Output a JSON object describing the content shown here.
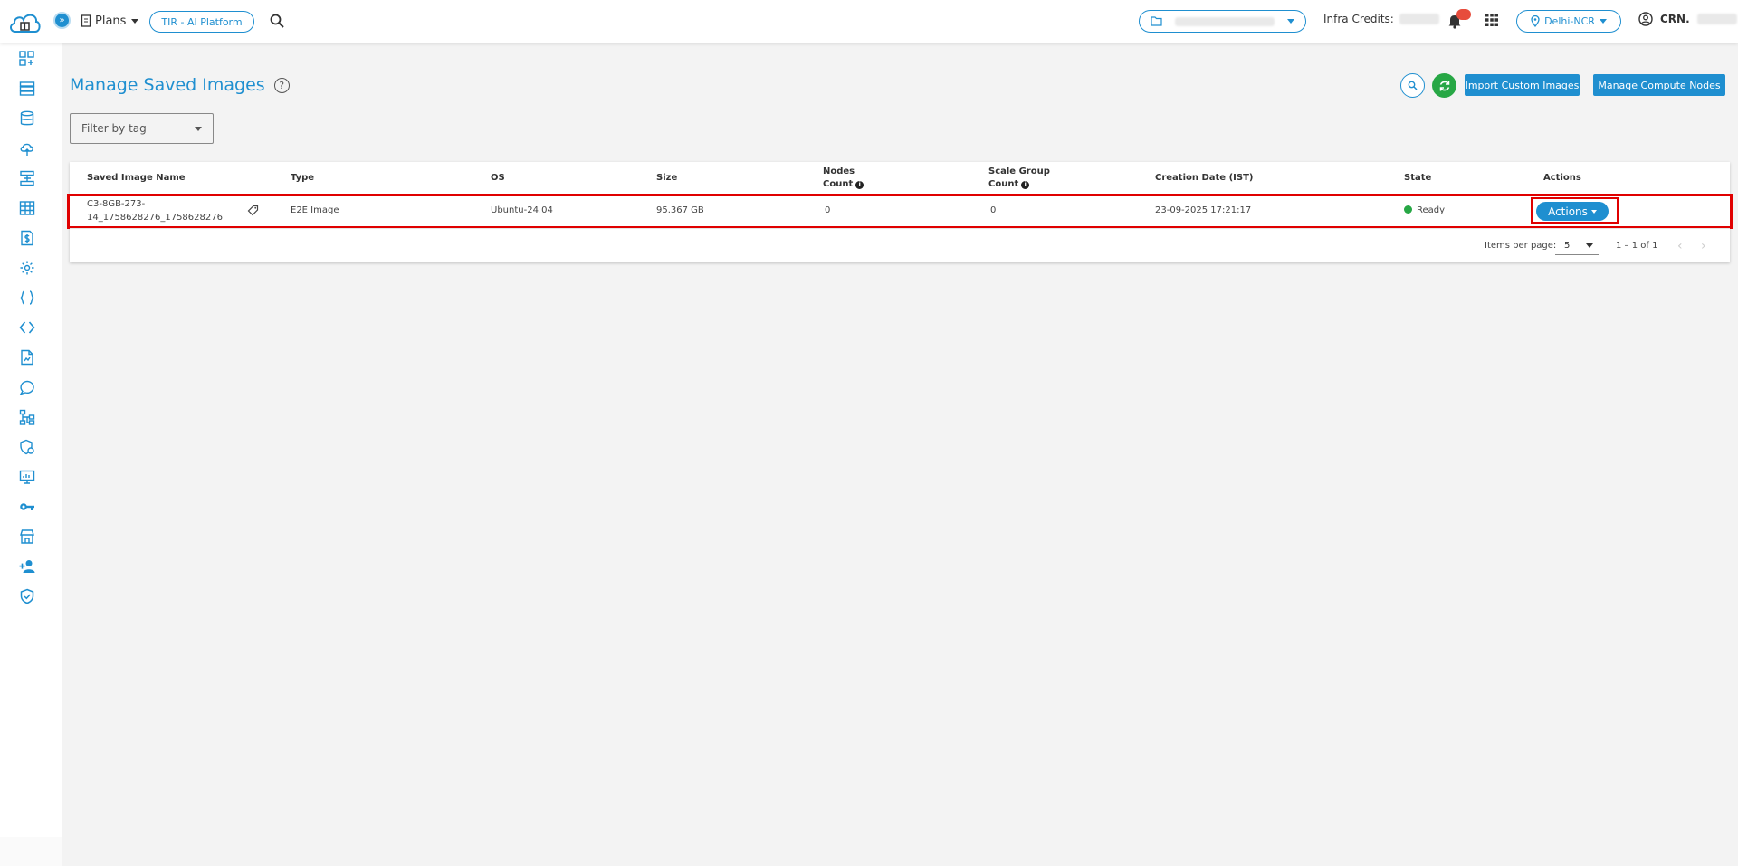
{
  "header": {
    "plans_label": "Plans",
    "platform_label": "TIR - AI Platform",
    "infra_credits_label": "Infra Credits:",
    "region_label": "Delhi-NCR",
    "crn_label": "CRN."
  },
  "sidebar": {
    "items": [
      "dashboard-add",
      "servers",
      "database",
      "cloud-upload",
      "network",
      "storage-grid",
      "billing",
      "settings",
      "api-braces",
      "code",
      "document",
      "chat",
      "tree",
      "security-settings",
      "monitor",
      "key",
      "marketplace",
      "add-user",
      "shield"
    ]
  },
  "page": {
    "title": "Manage Saved Images",
    "import_button": "Import Custom Images",
    "manage_nodes_button": "Manage Compute Nodes",
    "filter_placeholder": "Filter by tag"
  },
  "table": {
    "headers": {
      "name": "Saved Image Name",
      "type": "Type",
      "os": "OS",
      "size": "Size",
      "nodes_line1": "Nodes",
      "nodes_line2": "Count",
      "scale_line1": "Scale Group",
      "scale_line2": "Count",
      "creation": "Creation Date (IST)",
      "state": "State",
      "actions": "Actions"
    },
    "rows": [
      {
        "name_line1": "C3-8GB-273-",
        "name_line2": "14_1758628276_1758628276",
        "type": "E2E Image",
        "os": "Ubuntu-24.04",
        "size": "95.367 GB",
        "nodes_count": "0",
        "scale_count": "0",
        "creation_date": "23-09-2025 17:21:17",
        "state": "Ready",
        "actions_label": "Actions"
      }
    ],
    "items_per_page_label": "Items per page:",
    "items_per_page_value": "5",
    "range_label": "1 – 1 of 1"
  },
  "colors": {
    "accent": "#1f8fd0",
    "success": "#27a745",
    "highlight": "#e00000"
  }
}
